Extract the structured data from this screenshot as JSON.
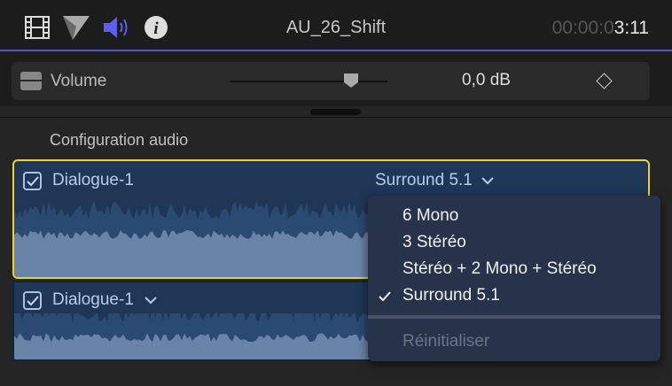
{
  "header": {
    "title": "AU_26_Shift",
    "timecode_dim": "00:00:0",
    "timecode_bright": "3:11",
    "icons": [
      "film-icon",
      "color-icon",
      "audio-icon",
      "info-icon"
    ]
  },
  "volume": {
    "label": "Volume",
    "value": "0,0 dB",
    "slider_fraction": 0.77
  },
  "section": {
    "title": "Configuration audio"
  },
  "clips": [
    {
      "name": "Dialogue-1",
      "checked": true,
      "config": "Surround 5.1"
    },
    {
      "name": "Dialogue-1",
      "checked": true
    }
  ],
  "menu": {
    "items": [
      "6 Mono",
      "3 Stéréo",
      "Stéréo + 2 Mono + Stéréo",
      "Surround 5.1"
    ],
    "selected": "Surround 5.1",
    "reset": "Réinitialiser"
  },
  "colors": {
    "accent": "#5656c8",
    "selection": "#f0d32a",
    "clip": "#1f3656",
    "wave": "#6a84a8"
  }
}
